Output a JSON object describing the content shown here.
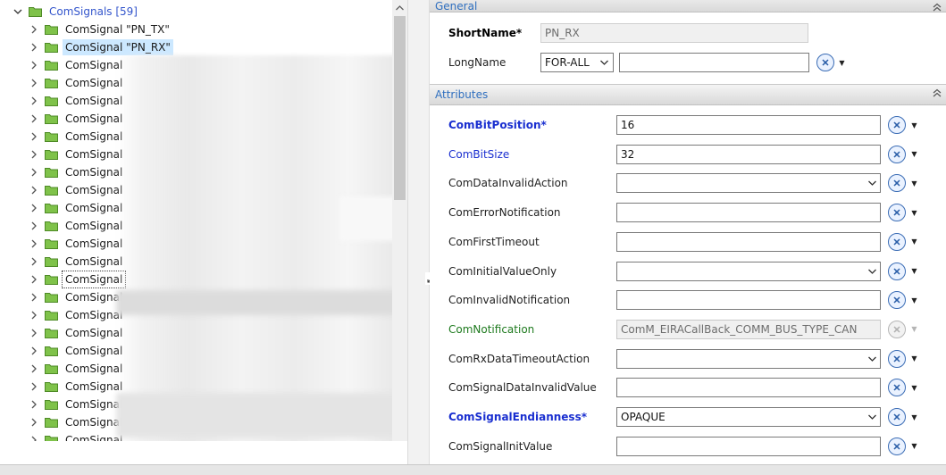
{
  "tree": {
    "root_label": "ComSignals [59]",
    "items": [
      {
        "label": "ComSignal \"PN_TX\""
      },
      {
        "label": "ComSignal \"PN_RX\"",
        "state": "selected"
      },
      {
        "label": "ComSignal"
      },
      {
        "label": "ComSignal"
      },
      {
        "label": "ComSignal"
      },
      {
        "label": "ComSignal"
      },
      {
        "label": "ComSignal"
      },
      {
        "label": "ComSignal"
      },
      {
        "label": "ComSignal"
      },
      {
        "label": "ComSignal"
      },
      {
        "label": "ComSignal"
      },
      {
        "label": "ComSignal"
      },
      {
        "label": "ComSignal"
      },
      {
        "label": "ComSignal"
      },
      {
        "label": "ComSignal",
        "state": "focused"
      },
      {
        "label": "ComSignal"
      },
      {
        "label": "ComSignal"
      },
      {
        "label": "ComSignal"
      },
      {
        "label": "ComSignal"
      },
      {
        "label": "ComSignal"
      },
      {
        "label": "ComSignal"
      },
      {
        "label": "ComSignal"
      },
      {
        "label": "ComSignal"
      },
      {
        "label": "ComSignal"
      }
    ]
  },
  "general": {
    "title": "General",
    "shortname_label": "ShortName*",
    "shortname_value": "PN_RX",
    "longname_label": "LongName",
    "language_value": "FOR-ALL",
    "longname_value": ""
  },
  "attributes": {
    "title": "Attributes",
    "rows": [
      {
        "label": "ComBitPosition*",
        "style": "bold-blue",
        "kind": "text",
        "value": "16"
      },
      {
        "label": "ComBitSize",
        "style": "blue",
        "kind": "text",
        "value": "32"
      },
      {
        "label": "ComDataInvalidAction",
        "style": "plain",
        "kind": "combo",
        "value": ""
      },
      {
        "label": "ComErrorNotification",
        "style": "plain",
        "kind": "text",
        "value": ""
      },
      {
        "label": "ComFirstTimeout",
        "style": "plain",
        "kind": "text",
        "value": ""
      },
      {
        "label": "ComInitialValueOnly",
        "style": "plain",
        "kind": "combo",
        "value": ""
      },
      {
        "label": "ComInvalidNotification",
        "style": "plain",
        "kind": "text",
        "value": ""
      },
      {
        "label": "ComNotification",
        "style": "green",
        "kind": "disabled",
        "value": "ComM_EIRACallBack_COMM_BUS_TYPE_CAN"
      },
      {
        "label": "ComRxDataTimeoutAction",
        "style": "plain",
        "kind": "combo",
        "value": ""
      },
      {
        "label": "ComSignalDataInvalidValue",
        "style": "plain",
        "kind": "text",
        "value": ""
      },
      {
        "label": "ComSignalEndianness*",
        "style": "bold-blue",
        "kind": "combo",
        "value": "OPAQUE"
      },
      {
        "label": "ComSignalInitValue",
        "style": "plain",
        "kind": "text",
        "value": ""
      }
    ]
  },
  "icons": {
    "expand": "chevron-right-icon",
    "collapse": "chevron-down-icon",
    "folder": "folder-icon",
    "action": "reset-action-icon",
    "dropdown": "caret-down-icon"
  },
  "colors": {
    "folder_fill": "#7fc24a",
    "folder_stroke": "#4e8a26",
    "selection": "#cce8ff",
    "section_title": "#2f6fbf",
    "mandatory_blue": "#1a2fd0",
    "green_label": "#1e7a1e"
  }
}
